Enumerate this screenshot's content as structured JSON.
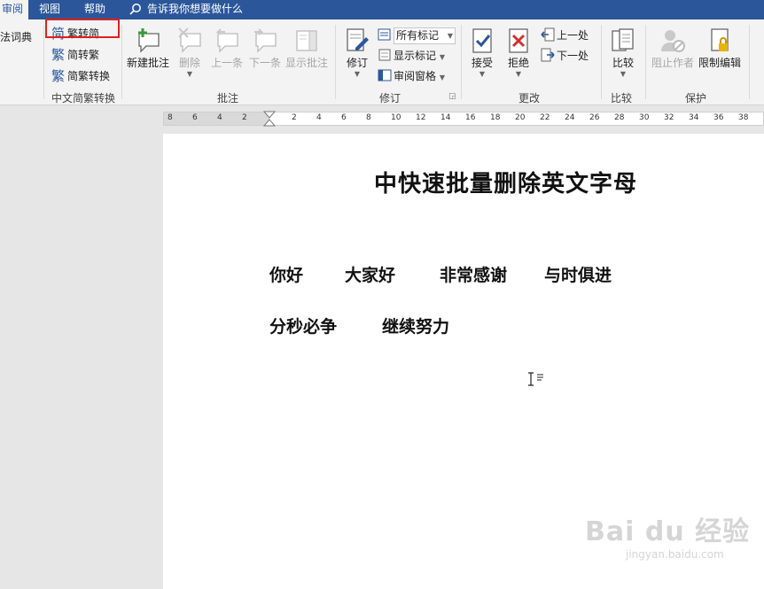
{
  "tabs": {
    "review": "审阅",
    "view": "视图",
    "help": "帮助"
  },
  "tell_me": "告诉我你想要做什么",
  "ribbon": {
    "dictionary_label": "法词典",
    "chinese_conversion": {
      "trad_to_simp": "繁转简",
      "simp_to_trad": "简转繁",
      "convert": "简繁转换",
      "group_label": "中文简繁转换"
    },
    "comments": {
      "new": "新建批注",
      "delete": "删除",
      "previous": "上一条",
      "next": "下一条",
      "show": "显示批注",
      "group_label": "批注"
    },
    "tracking": {
      "track_changes": "修订",
      "markup_option": "所有标记",
      "show_markup": "显示标记",
      "reviewing_pane": "审阅窗格",
      "group_label": "修订"
    },
    "changes": {
      "accept": "接受",
      "reject": "拒绝",
      "previous": "上一处",
      "next": "下一处",
      "group_label": "更改"
    },
    "compare": {
      "compare": "比较",
      "group_label": "比较"
    },
    "protect": {
      "block_authors": "阻止作者",
      "restrict_editing": "限制编辑",
      "group_label": "保护"
    }
  },
  "ruler_ticks": [
    "8",
    "6",
    "4",
    "2",
    "2",
    "4",
    "6",
    "8",
    "10",
    "12",
    "14",
    "16",
    "18",
    "20",
    "22",
    "24",
    "26",
    "28",
    "30",
    "32",
    "34",
    "36",
    "38"
  ],
  "document": {
    "title": "中快速批量删除英文字母",
    "line1": [
      "你好",
      "大家好",
      "非常感谢",
      "与时俱进"
    ],
    "line2": [
      "分秒必争",
      "继续努力"
    ]
  },
  "watermark": {
    "brand": "Bai du 经验",
    "url": "jingyan.baidu.com"
  },
  "colors": {
    "accent": "#2b579a",
    "highlight": "#e02020"
  }
}
